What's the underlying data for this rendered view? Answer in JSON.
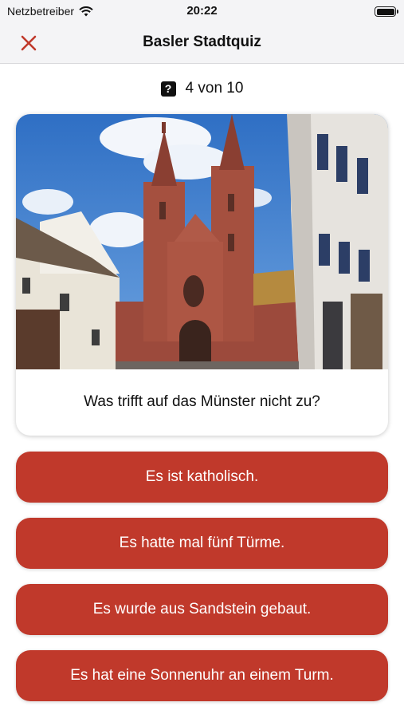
{
  "status_bar": {
    "carrier": "Netzbetreiber",
    "time": "20:22",
    "icons": [
      "wifi-icon",
      "battery-icon"
    ]
  },
  "nav": {
    "title": "Basler Stadtquiz",
    "close_icon": "close-icon",
    "accent": "#c0392b"
  },
  "progress": {
    "icon": "question-mark-icon",
    "icon_glyph": "?",
    "text": "4 von 10"
  },
  "question": {
    "image": "basel-minster-photo",
    "text": "Was trifft auf das Münster nicht zu?"
  },
  "answers": [
    {
      "label": "Es ist katholisch."
    },
    {
      "label": "Es hatte mal fünf Türme."
    },
    {
      "label": "Es wurde aus Sandstein gebaut."
    },
    {
      "label": "Es hat eine Sonnenuhr an einem Turm."
    }
  ],
  "colors": {
    "answer_button": "#c0392b",
    "bar_background": "#f4f4f6"
  }
}
